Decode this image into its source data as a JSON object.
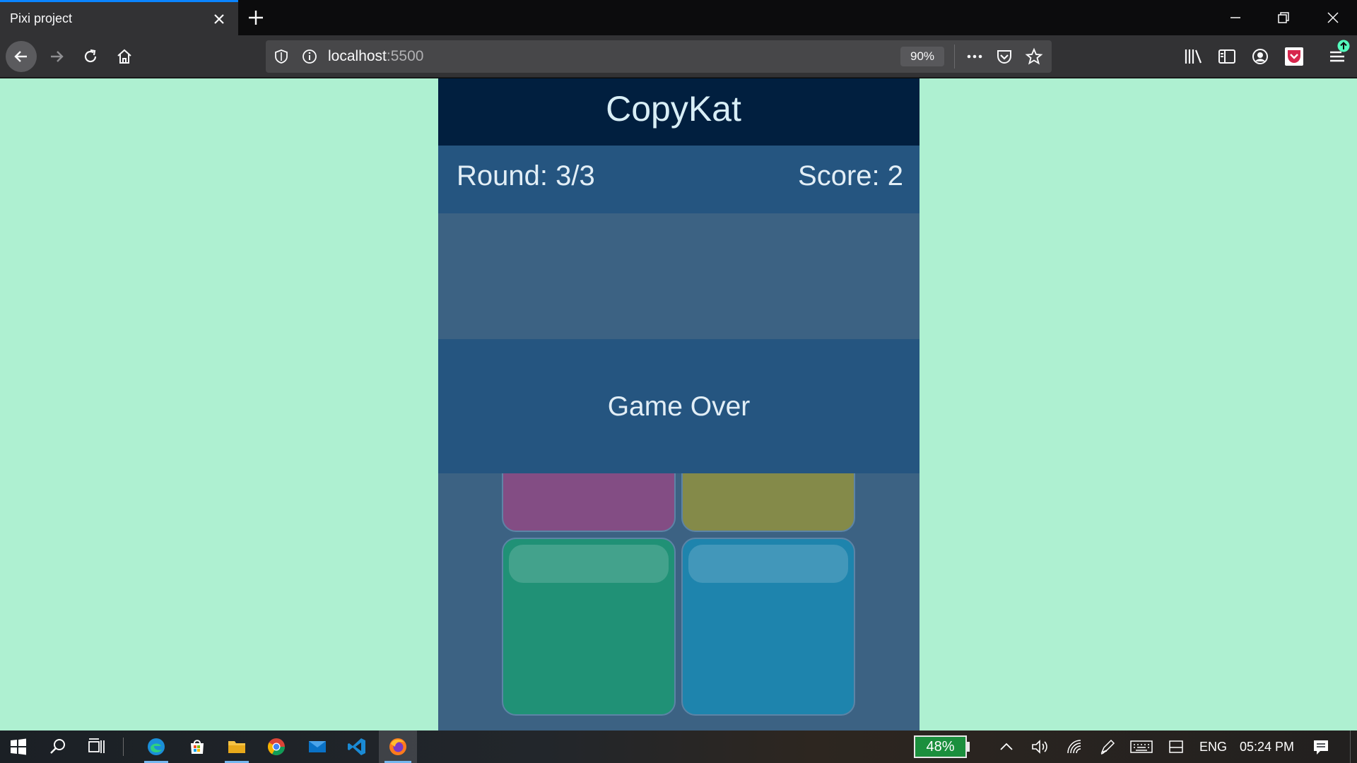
{
  "browser": {
    "tab_title": "Pixi project",
    "url_host": "localhost",
    "url_port": ":5500",
    "zoom": "90%"
  },
  "game": {
    "title": "CopyKat",
    "round": "Round: 3/3",
    "score": "Score: 2",
    "overlay_text": "Game Over",
    "pads": [
      {
        "name": "pad-purple",
        "color": "#834d84"
      },
      {
        "name": "pad-olive",
        "color": "#848a49"
      },
      {
        "name": "pad-green",
        "color": "#209176"
      },
      {
        "name": "pad-blue",
        "color": "#1e84ad"
      }
    ],
    "colors": {
      "page_background": "#aef0d1",
      "header": "#011f3f",
      "panel": "#255580",
      "board": "#3c6283"
    }
  },
  "taskbar": {
    "battery": "48%",
    "language": "ENG",
    "time": "05:24 PM",
    "apps": [
      "windows-start",
      "search",
      "task-view",
      "edge",
      "store",
      "file-explorer",
      "chrome",
      "mail",
      "vscode",
      "firefox"
    ]
  }
}
